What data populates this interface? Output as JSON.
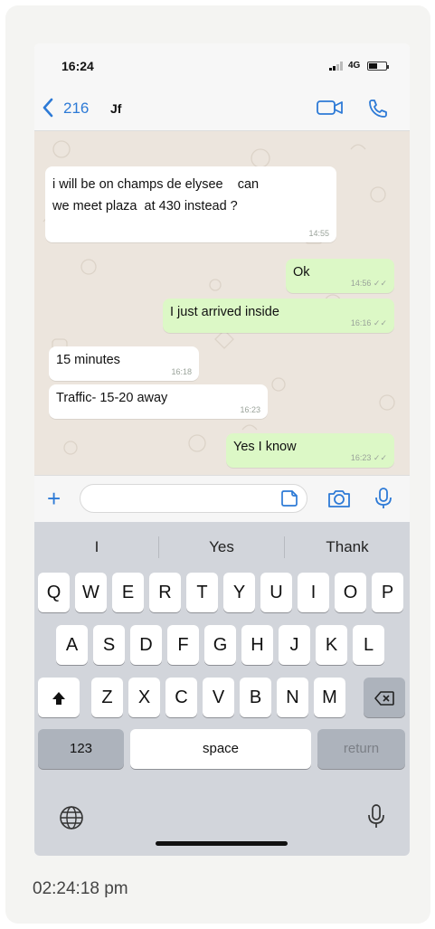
{
  "status_bar": {
    "time": "16:24",
    "network": "4G"
  },
  "nav": {
    "back_count": "216",
    "contact_name": "Jf"
  },
  "messages": [
    {
      "dir": "in",
      "text": "i will be on champs de elysee    can\nwe meet plaza  at 430 instead ?",
      "time": "14:55"
    },
    {
      "dir": "out",
      "text": "Ok",
      "time": "14:56"
    },
    {
      "dir": "out",
      "text": "I just arrived inside",
      "time": "16:16"
    },
    {
      "dir": "in",
      "text": "15 minutes",
      "time": "16:18"
    },
    {
      "dir": "in",
      "text": "Traffic- 15-20 away",
      "time": "16:23"
    },
    {
      "dir": "out",
      "text": "Yes I know",
      "time": "16:23"
    }
  ],
  "input": {
    "placeholder": ""
  },
  "keyboard": {
    "suggestions": [
      "I",
      "Yes",
      "Thank"
    ],
    "row1": [
      "Q",
      "W",
      "E",
      "R",
      "T",
      "Y",
      "U",
      "I",
      "O",
      "P"
    ],
    "row2": [
      "A",
      "S",
      "D",
      "F",
      "G",
      "H",
      "J",
      "K",
      "L"
    ],
    "row3": [
      "Z",
      "X",
      "C",
      "V",
      "B",
      "N",
      "M"
    ],
    "numbers_key": "123",
    "space_key": "space",
    "return_key": "return"
  },
  "icons": [
    "chevron-left-icon",
    "video-call-icon",
    "phone-icon",
    "plus-icon",
    "sticker-icon",
    "camera-icon",
    "microphone-icon",
    "globe-icon",
    "shift-icon",
    "backspace-icon"
  ],
  "colors": {
    "accent": "#2d7ad6",
    "outgoing_bubble": "#dcf8c6",
    "chat_background": "#ece5dd"
  },
  "footer_timestamp": "02:24:18 pm"
}
